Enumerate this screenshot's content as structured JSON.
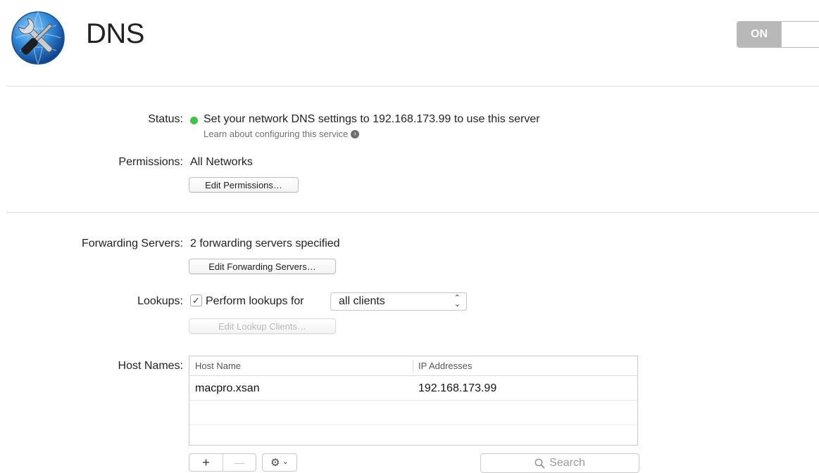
{
  "header": {
    "title": "DNS",
    "toggle_label": "ON"
  },
  "status": {
    "label": "Status:",
    "text": "Set your network DNS settings to 192.168.173.99 to use this server",
    "link": "Learn about configuring this service",
    "dot_color": "#3dc54a"
  },
  "permissions": {
    "label": "Permissions:",
    "value": "All Networks",
    "button": "Edit Permissions…"
  },
  "forwarding": {
    "label": "Forwarding Servers:",
    "value": "2 forwarding servers specified",
    "button": "Edit Forwarding Servers…"
  },
  "lookups": {
    "label": "Lookups:",
    "checkbox_label": "Perform lookups for",
    "checked": true,
    "select_value": "all clients",
    "button": "Edit Lookup Clients…"
  },
  "hostnames": {
    "label": "Host Names:",
    "columns": [
      "Host Name",
      "IP Addresses"
    ],
    "rows": [
      {
        "host": "macpro.xsan",
        "ip": "192.168.173.99"
      }
    ]
  },
  "toolbar": {
    "add": "+",
    "remove": "—",
    "gear_caret": "⌄",
    "search_placeholder": "Search"
  }
}
